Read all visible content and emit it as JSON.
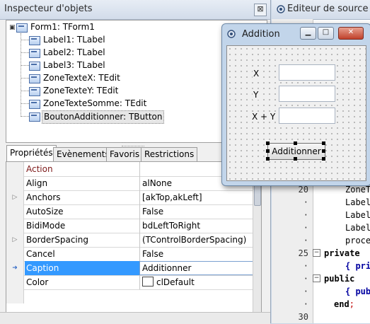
{
  "inspector": {
    "title": "Inspecteur d'objets",
    "close_glyph": "⊠",
    "tree": [
      {
        "label": "Form1: TForm1",
        "icon": "form-icon"
      },
      {
        "label": "Label1: TLabel",
        "icon": "component-icon"
      },
      {
        "label": "Label2: TLabel",
        "icon": "component-icon"
      },
      {
        "label": "Label3: TLabel",
        "icon": "component-icon"
      },
      {
        "label": "ZoneTexteX: TEdit",
        "icon": "component-icon"
      },
      {
        "label": "ZoneTexteY: TEdit",
        "icon": "component-icon"
      },
      {
        "label": "ZoneTexteSomme: TEdit",
        "icon": "component-icon"
      },
      {
        "label": "BoutonAdditionner: TButton",
        "icon": "component-icon"
      }
    ],
    "tabs": [
      "Propriétés",
      "Evènements",
      "Favoris",
      "Restrictions"
    ],
    "active_tab": "Propriétés",
    "properties": [
      {
        "name": "Action",
        "value": "",
        "kind": "category"
      },
      {
        "name": "Align",
        "value": "alNone"
      },
      {
        "name": "Anchors",
        "value": "[akTop,akLeft]",
        "expandable": true
      },
      {
        "name": "AutoSize",
        "value": "False"
      },
      {
        "name": "BidiMode",
        "value": "bdLeftToRight"
      },
      {
        "name": "BorderSpacing",
        "value": "(TControlBorderSpacing)",
        "expandable": true
      },
      {
        "name": "Cancel",
        "value": "False"
      },
      {
        "name": "Caption",
        "value": "Additionner",
        "selected": true
      },
      {
        "name": "Color",
        "value": "clDefault",
        "swatch": "#ffffff"
      }
    ]
  },
  "editor": {
    "title": "Editeur de source",
    "line_numbers": [
      "20",
      "·",
      "·",
      "·",
      "·",
      "25",
      "·",
      "·",
      "·",
      "·",
      "30"
    ],
    "lines": [
      {
        "text": "ZoneT"
      },
      {
        "text": "Label"
      },
      {
        "text": "Label"
      },
      {
        "text": "Label"
      },
      {
        "text": "proce"
      },
      {
        "text": "private",
        "style": "kw"
      },
      {
        "text": "{ pri",
        "style": "blue"
      },
      {
        "text": "public ",
        "style": "kw"
      },
      {
        "text": "{ pub",
        "style": "blue"
      },
      {
        "text": "end",
        "style": "kw",
        "suffix": ";"
      }
    ]
  },
  "form_window": {
    "title": "Addition",
    "controls": {
      "label_x": "X",
      "label_y": "Y",
      "label_sum": "X + Y",
      "button": "Additionner"
    }
  },
  "colors": {
    "selection": "#3399ff",
    "category": "#7d1a1a",
    "comment": "#0000a0",
    "close_button": "#c0412b"
  }
}
